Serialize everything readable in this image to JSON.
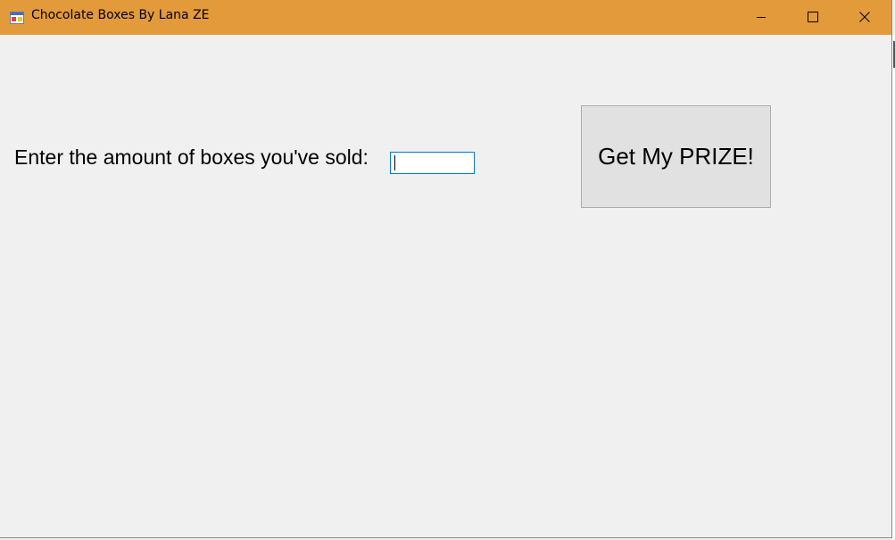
{
  "window": {
    "title": "Chocolate Boxes By Lana ZE",
    "titlebar_color": "#e39a3a",
    "icons": {
      "app": "app-window-icon",
      "minimize": "minimize-icon",
      "maximize": "maximize-icon",
      "close": "close-icon"
    }
  },
  "form": {
    "prompt_label": "Enter the amount of boxes you've sold:",
    "boxes_input_value": "",
    "prize_button_label": "Get My PRIZE!"
  }
}
